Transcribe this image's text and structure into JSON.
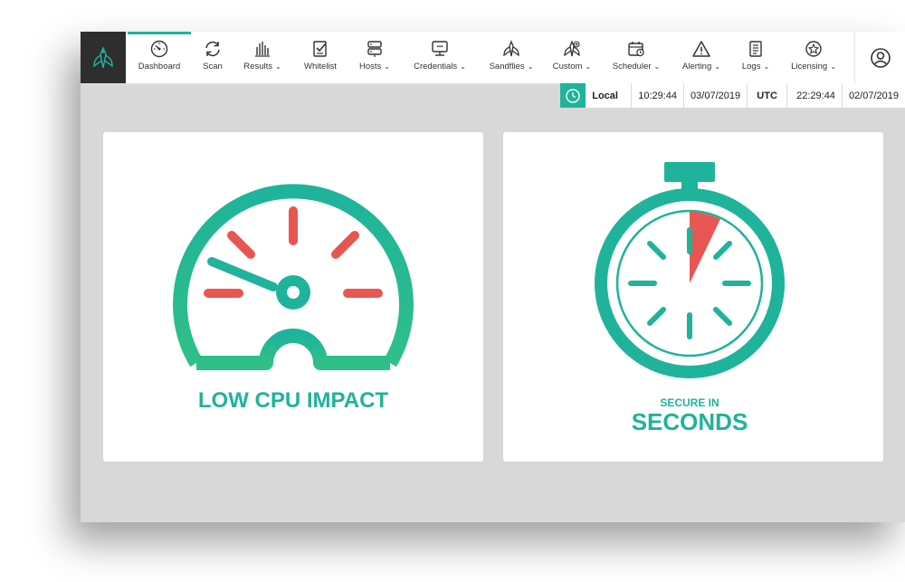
{
  "colors": {
    "accent": "#1fb39b",
    "alert": "#e85652",
    "topbar_bg": "#ffffff",
    "brand_bg": "#2e2e2e",
    "content_bg": "#d8d8d8"
  },
  "nav": {
    "items": [
      {
        "label": "Dashboard",
        "icon": "dashboard-gauge-icon",
        "dropdown": false,
        "active": true
      },
      {
        "label": "Scan",
        "icon": "scan-refresh-icon",
        "dropdown": false
      },
      {
        "label": "Results",
        "icon": "results-bars-icon",
        "dropdown": true
      },
      {
        "label": "Whitelist",
        "icon": "whitelist-checklist-icon",
        "dropdown": false
      },
      {
        "label": "Hosts",
        "icon": "hosts-server-icon",
        "dropdown": true
      },
      {
        "label": "Credentials",
        "icon": "credentials-key-icon",
        "dropdown": true
      },
      {
        "label": "Sandflies",
        "icon": "sandfly-icon",
        "dropdown": true
      },
      {
        "label": "Custom",
        "icon": "custom-sandfly-icon",
        "dropdown": true
      },
      {
        "label": "Scheduler",
        "icon": "scheduler-calendar-icon",
        "dropdown": true
      },
      {
        "label": "Alerting",
        "icon": "alert-triangle-icon",
        "dropdown": true
      },
      {
        "label": "Logs",
        "icon": "logs-document-icon",
        "dropdown": true
      },
      {
        "label": "Licensing",
        "icon": "licensing-badge-icon",
        "dropdown": true
      }
    ]
  },
  "clock": {
    "local_label": "Local",
    "local_time": "10:29:44",
    "local_date": "03/07/2019",
    "utc_label": "UTC",
    "utc_time": "22:29:44",
    "utc_date": "02/07/2019"
  },
  "cards": {
    "cpu": {
      "title": "LOW CPU IMPACT",
      "icon": "speedometer-gauge-icon"
    },
    "secure": {
      "line1": "SECURE IN",
      "line2": "SECONDS",
      "icon": "stopwatch-icon"
    }
  }
}
